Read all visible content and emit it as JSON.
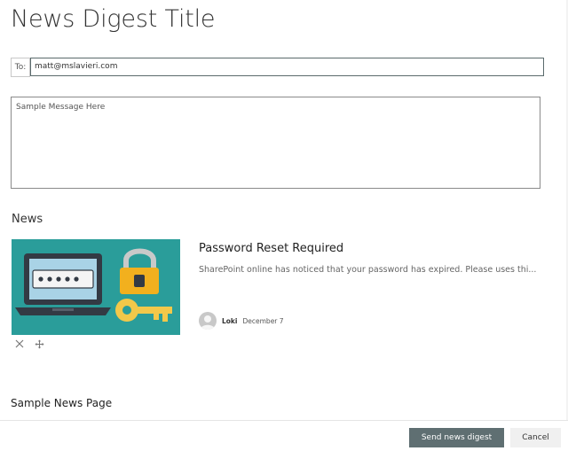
{
  "page": {
    "title": "News Digest Title"
  },
  "recipients": {
    "to_label": "To:",
    "to_value": "matt@mslavieri.com"
  },
  "message": {
    "text": "Sample Message Here"
  },
  "news": {
    "heading": "News",
    "article": {
      "title": "Password Reset Required",
      "description": "SharePoint online has noticed that your password has expired. Please uses thi...",
      "author": "Loki",
      "date": "December 7",
      "image_icon": "laptop-password-lock-key-illustration",
      "tools": {
        "remove_icon": "close-icon",
        "move_icon": "move-icon"
      }
    }
  },
  "sample_page": {
    "title": "Sample News Page"
  },
  "footer": {
    "send_label": "Send news digest",
    "cancel_label": "Cancel"
  },
  "colors": {
    "image_bg": "#2a9d9a",
    "send_button": "#5f6f72",
    "cancel_button": "#f0f0f0"
  }
}
